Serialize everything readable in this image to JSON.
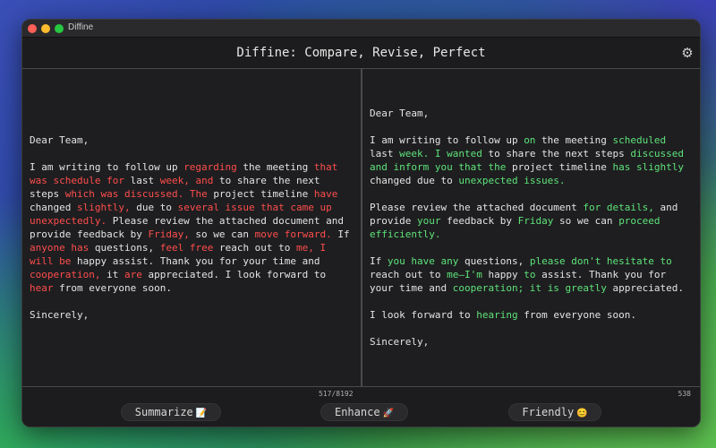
{
  "window": {
    "title": "Diffine"
  },
  "header": {
    "title": "Diffine: Compare, Revise, Perfect",
    "settings_icon": "gear-icon"
  },
  "colors": {
    "deleted": "#ff4d4d",
    "inserted": "#5ee37a",
    "text": "#e4e4e4"
  },
  "left_panel": {
    "greeting": "Dear Team,",
    "p1": [
      {
        "t": "I am writing to follow up "
      },
      {
        "t": "regarding",
        "c": "del"
      },
      {
        "t": " the meeting "
      },
      {
        "t": "that was schedule for",
        "c": "del"
      },
      {
        "t": " last "
      },
      {
        "t": "week, and",
        "c": "del"
      },
      {
        "t": " to share the next steps "
      },
      {
        "t": "which was discussed. The",
        "c": "del"
      },
      {
        "t": " project timeline "
      },
      {
        "t": "have",
        "c": "del"
      },
      {
        "t": " changed "
      },
      {
        "t": "slightly,",
        "c": "del"
      },
      {
        "t": " due to "
      },
      {
        "t": "several issue that came up unexpectedly.",
        "c": "del"
      },
      {
        "t": " Please review the attached document and provide feedback by "
      },
      {
        "t": "Friday,",
        "c": "del"
      },
      {
        "t": " so we can "
      },
      {
        "t": "move forward.",
        "c": "del"
      },
      {
        "t": " If "
      },
      {
        "t": "anyone has",
        "c": "del"
      },
      {
        "t": " questions, "
      },
      {
        "t": "feel free",
        "c": "del"
      },
      {
        "t": " reach out to "
      },
      {
        "t": "me, I will be",
        "c": "del"
      },
      {
        "t": " happy assist. Thank you for your time and "
      },
      {
        "t": "cooperation,",
        "c": "del"
      },
      {
        "t": " it "
      },
      {
        "t": "are",
        "c": "del"
      },
      {
        "t": " appreciated. I look forward to "
      },
      {
        "t": "hear",
        "c": "del"
      },
      {
        "t": " from everyone soon."
      }
    ],
    "closing": "Sincerely,",
    "count": "517/8192"
  },
  "right_panel": {
    "greeting": "Dear Team,",
    "p1": [
      {
        "t": "I am writing to follow up "
      },
      {
        "t": "on",
        "c": "ins"
      },
      {
        "t": " the meeting "
      },
      {
        "t": "scheduled",
        "c": "ins"
      },
      {
        "t": " last "
      },
      {
        "t": "week. I wanted",
        "c": "ins"
      },
      {
        "t": " to share the next steps "
      },
      {
        "t": "discussed and inform you that the",
        "c": "ins"
      },
      {
        "t": " project timeline "
      },
      {
        "t": "has slightly",
        "c": "ins"
      },
      {
        "t": " changed due to "
      },
      {
        "t": "unexpected issues.",
        "c": "ins"
      }
    ],
    "p2": [
      {
        "t": "Please review the attached document "
      },
      {
        "t": "for details,",
        "c": "ins"
      },
      {
        "t": " and provide "
      },
      {
        "t": "your",
        "c": "ins"
      },
      {
        "t": " feedback by "
      },
      {
        "t": "Friday",
        "c": "ins"
      },
      {
        "t": " so we can "
      },
      {
        "t": "proceed efficiently.",
        "c": "ins"
      }
    ],
    "p3": [
      {
        "t": "If "
      },
      {
        "t": "you have any",
        "c": "ins"
      },
      {
        "t": " questions, "
      },
      {
        "t": "please don't hesitate to",
        "c": "ins"
      },
      {
        "t": " reach out to "
      },
      {
        "t": "me—I'm",
        "c": "ins"
      },
      {
        "t": " happy "
      },
      {
        "t": "to",
        "c": "ins"
      },
      {
        "t": " assist. Thank you for your time and "
      },
      {
        "t": "cooperation; it",
        "c": "ins"
      },
      {
        "t": " "
      },
      {
        "t": "is greatly",
        "c": "ins"
      },
      {
        "t": " appreciated."
      }
    ],
    "p4": [
      {
        "t": "I look forward to "
      },
      {
        "t": "hearing",
        "c": "ins"
      },
      {
        "t": " from everyone soon."
      }
    ],
    "closing": "Sincerely,",
    "count": "538"
  },
  "actions": {
    "summarize": {
      "label": "Summarize",
      "emoji": "📝"
    },
    "enhance": {
      "label": "Enhance",
      "emoji": "🚀"
    },
    "friendly": {
      "label": "Friendly",
      "emoji": "😊"
    }
  }
}
